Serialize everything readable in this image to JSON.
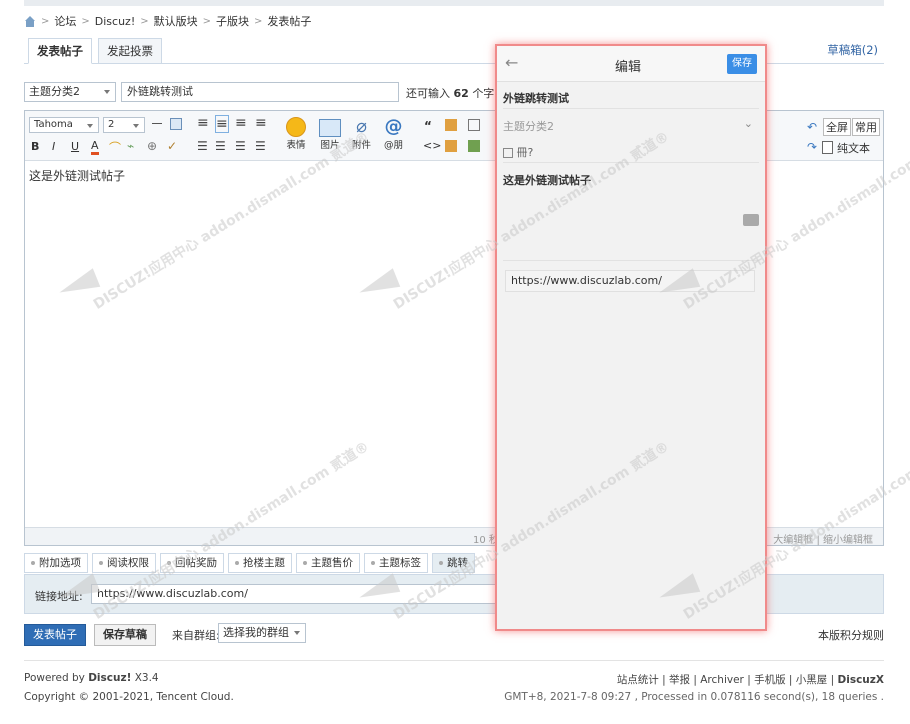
{
  "breadcrumb": [
    "论坛",
    "Discuz!",
    "默认版块",
    "子版块",
    "发表帖子"
  ],
  "tabs": {
    "post": "发表帖子",
    "poll": "发起投票"
  },
  "draft_box": "草稿箱(2)",
  "form": {
    "category": "主题分类2",
    "title": "外链跳转测试",
    "char_hint_prefix": "还可输入",
    "char_hint_count": "62",
    "char_hint_suffix": "个字",
    "font": "Tahoma",
    "size": "2"
  },
  "toolbar": {
    "emoji": "表情",
    "image": "图片",
    "attach": "附件",
    "at": "@朋",
    "fullscreen": "全屏",
    "common": "常用",
    "plaintext": "纯文本"
  },
  "editor": {
    "content": "这是外链测试帖子",
    "status_left": "10 秒",
    "status_right": "大编辑框 | 缩小编辑框"
  },
  "options": [
    "附加选项",
    "阅读权限",
    "回帖奖励",
    "抢楼主题",
    "主题售价",
    "主题标签",
    "跳转"
  ],
  "link": {
    "label": "链接地址:",
    "value": "https://www.discuzlab.com/"
  },
  "actions": {
    "submit": "发表帖子",
    "save_draft": "保存草稿",
    "group_label": "来自群组:",
    "group_select": "选择我的群组",
    "rules": "本版积分规则"
  },
  "footer": {
    "powered_prefix": "Powered by",
    "powered_brand": "Discuz!",
    "version": "X3.4",
    "copyright": "Copyright © 2001-2021, Tencent Cloud.",
    "links": [
      "站点统计",
      "举报",
      "Archiver",
      "手机版",
      "小黑屋",
      "DiscuzX"
    ],
    "meta": "GMT+8, 2021-7-8 09:27 , Processed in 0.078116 second(s), 18 queries ."
  },
  "mobile_panel": {
    "title": "编辑",
    "save": "保存",
    "post_title": "外链跳转测试",
    "category": "主题分类2",
    "content": "这是外链测试帖子",
    "link": "https://www.discuzlab.com/",
    "checkbox_label": "冊?"
  },
  "watermark_text": "DISCUZ!应用中心 addon.dismall.com 贰道®"
}
